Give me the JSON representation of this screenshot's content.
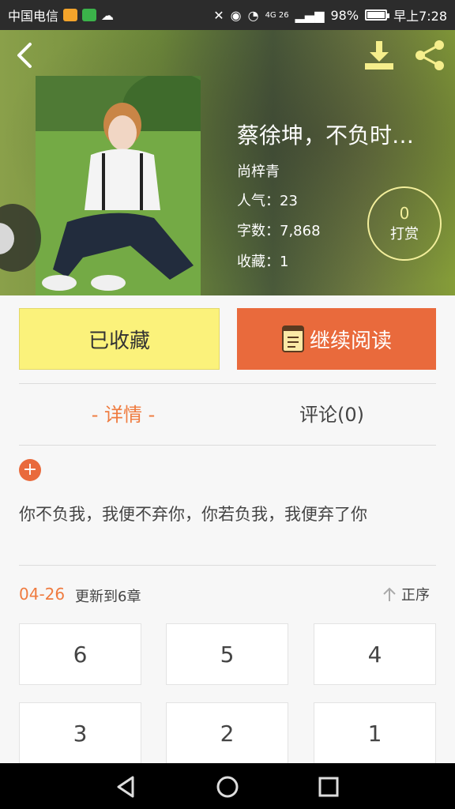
{
  "status_bar": {
    "carrier": "中国电信",
    "battery": "98%",
    "battery_level": 0.98,
    "time": "早上7:28",
    "network": "4G 26"
  },
  "header": {
    "book_title": "蔡徐坤，不负时…",
    "author": "尚梓青",
    "popularity": "人气：23",
    "word_count": "字数：7,868",
    "favorites": "收藏：1",
    "tip_count": "0",
    "tip_label": "打赏"
  },
  "actions": {
    "collected_label": "已收藏",
    "continue_label": "继续阅读"
  },
  "tabs": {
    "details": "- 详情 -",
    "comments": "评论(0)"
  },
  "detail": {
    "plus": "+",
    "description": "你不负我，我便不弃你，你若负我，我便弃了你"
  },
  "update": {
    "date": "04-26",
    "text": "更新到6章",
    "sort_label": "正序"
  },
  "chapters": [
    "6",
    "5",
    "4",
    "3",
    "2",
    "1"
  ],
  "colors": {
    "accent": "#e96a3c",
    "collected_bg": "#fbf27b",
    "tab_active": "#ef7b3f",
    "tip_ring": "#f3ef9c"
  }
}
